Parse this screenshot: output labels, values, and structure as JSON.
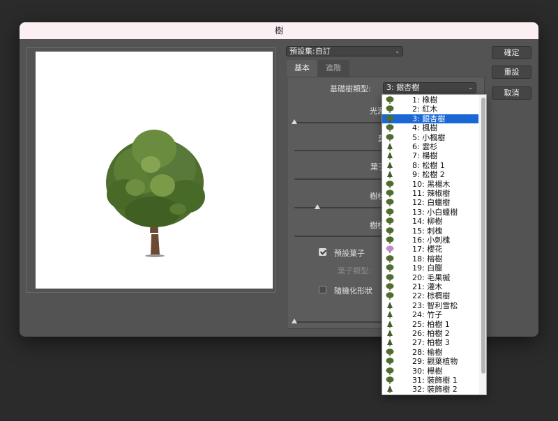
{
  "window": {
    "title": "樹"
  },
  "preset": {
    "value": "預設集:自訂"
  },
  "tabs": [
    {
      "label": "基本"
    },
    {
      "label": "進階"
    }
  ],
  "basic": {
    "base_tree_type_label": "基礎樹類型:",
    "base_tree_type_value": "3: 銀杏樹",
    "light_direction_label": "光源",
    "leaf_amount_label": "葉",
    "leaf_size_label": "葉子",
    "branch_height_label": "樹枝",
    "branch_thickness_label": "樹枝",
    "default_leaves_label": "預設葉子",
    "default_leaves_checked": true,
    "leaf_type_label": "葉子類型:",
    "randomize_label": "隨機化形狀",
    "randomize_checked": false
  },
  "buttons": {
    "ok": "確定",
    "reset": "重設",
    "cancel": "取消"
  },
  "tree_types": [
    {
      "label": "1: 橡樹",
      "icon": "tree-thumb"
    },
    {
      "label": "2: 紅木",
      "icon": "tree-thumb"
    },
    {
      "label": "3: 銀杏樹",
      "icon": "tree-thumb",
      "selected": true
    },
    {
      "label": "4: 楓樹",
      "icon": "tree-thumb"
    },
    {
      "label": "5: 小楓樹",
      "icon": "tree-thumb"
    },
    {
      "label": "6: 雲杉",
      "icon": "tree-thumb"
    },
    {
      "label": "7: 楊樹",
      "icon": "tree-thumb"
    },
    {
      "label": "8: 松樹 1",
      "icon": "tree-thumb"
    },
    {
      "label": "9: 松樹 2",
      "icon": "tree-thumb"
    },
    {
      "label": "10: 黑楊木",
      "icon": "tree-thumb"
    },
    {
      "label": "11: 辣椒樹",
      "icon": "tree-thumb"
    },
    {
      "label": "12: 白蠟樹",
      "icon": "tree-thumb"
    },
    {
      "label": "13: 小白蠟樹",
      "icon": "tree-thumb"
    },
    {
      "label": "14: 柳樹",
      "icon": "tree-thumb"
    },
    {
      "label": "15: 刺槐",
      "icon": "tree-thumb"
    },
    {
      "label": "16: 小刺槐",
      "icon": "tree-thumb"
    },
    {
      "label": "17: 櫻花",
      "icon": "tree-thumb"
    },
    {
      "label": "18: 榕樹",
      "icon": "tree-thumb"
    },
    {
      "label": "19: 白臘",
      "icon": "tree-thumb"
    },
    {
      "label": "20: 毛果槭",
      "icon": "tree-thumb"
    },
    {
      "label": "21: 灌木",
      "icon": "tree-thumb"
    },
    {
      "label": "22: 棕櫚樹",
      "icon": "tree-thumb"
    },
    {
      "label": "23: 智利雪松",
      "icon": "tree-thumb"
    },
    {
      "label": "24: 竹子",
      "icon": "tree-thumb"
    },
    {
      "label": "25: 柏樹 1",
      "icon": "tree-thumb"
    },
    {
      "label": "26: 柏樹 2",
      "icon": "tree-thumb"
    },
    {
      "label": "27: 柏樹 3",
      "icon": "tree-thumb"
    },
    {
      "label": "28: 榆樹",
      "icon": "tree-thumb"
    },
    {
      "label": "29: 觀葉植物",
      "icon": "tree-thumb"
    },
    {
      "label": "30: 櫸樹",
      "icon": "tree-thumb"
    },
    {
      "label": "31: 裝飾樹 1",
      "icon": "tree-thumb"
    },
    {
      "label": "32: 裝飾樹 2",
      "icon": "tree-thumb"
    }
  ],
  "colors": {
    "dialog_bg": "#535353",
    "title_bar": "#fbeff2",
    "selection": "#1a67d6",
    "foliage": "#4f6e2e"
  }
}
